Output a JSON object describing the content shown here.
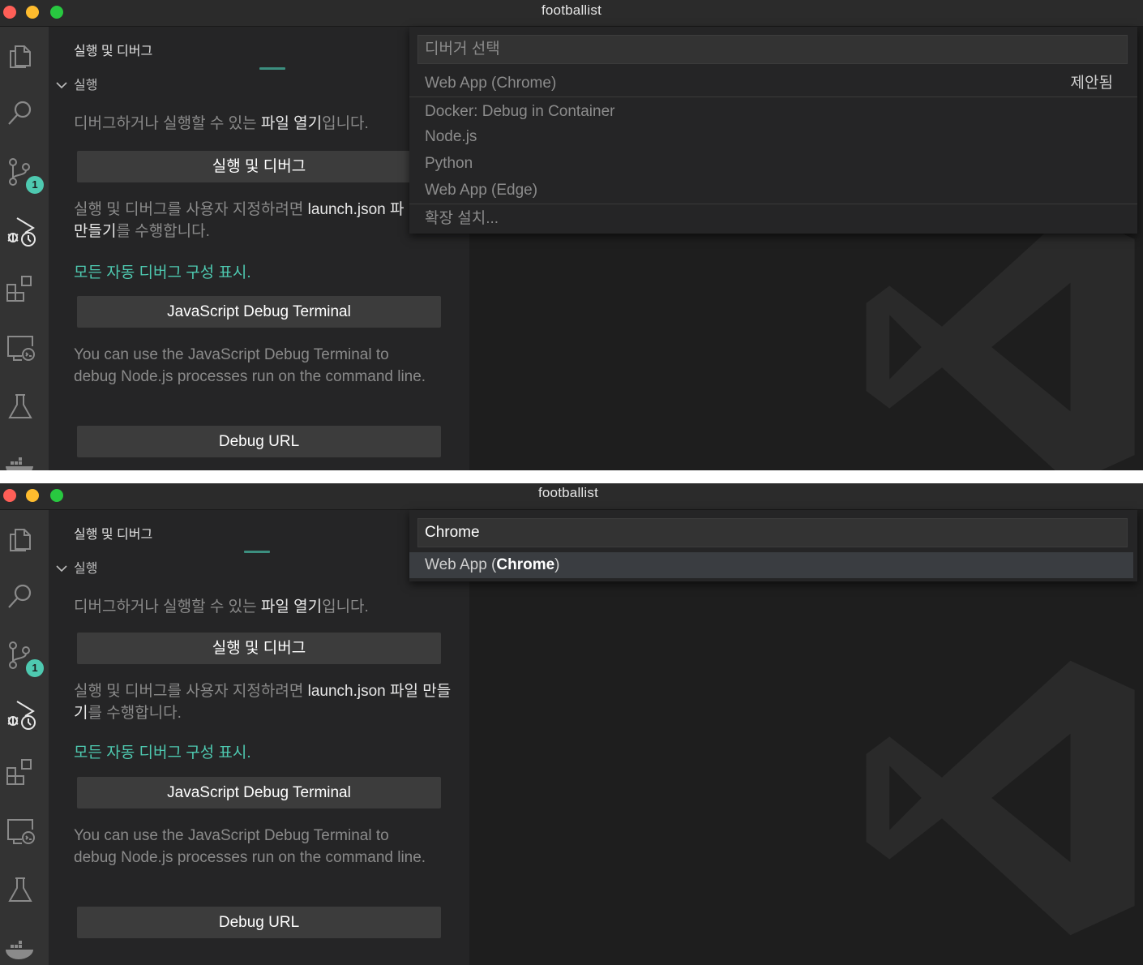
{
  "window": {
    "title": "footballist"
  },
  "activity": {
    "icons": [
      "explorer-icon",
      "search-icon",
      "source-control-icon",
      "run-debug-icon",
      "extensions-icon",
      "remote-explorer-icon",
      "testing-icon",
      "docker-icon"
    ],
    "source_control_badge": "1"
  },
  "sidebar": {
    "title": "실행 및 디버그",
    "section": "실행",
    "open_file_pre": "디버그하거나 실행할 수 있는 ",
    "open_file_link": "파일 열기",
    "open_file_post": "입니다.",
    "run_debug_button": "실행 및 디버그",
    "customize_pre": "실행 및 디버그를 사용자 지정하려면 ",
    "customize_link": "launch.json 파일 만들기",
    "customize_link_cut": "launch.json 파",
    "customize_link_line2": "만들기",
    "customize_post": "를 수행합니다.",
    "show_all": "모든 자동 디버그 구성 표시.",
    "js_terminal_button": "JavaScript Debug Terminal",
    "js_terminal_desc": "You can use the JavaScript Debug Terminal to debug Node.js processes run on the command line.",
    "debug_url_button": "Debug URL"
  },
  "palette1": {
    "placeholder": "디버거 선택",
    "items": [
      {
        "label": "Web App (Chrome)",
        "tag": "제안됨"
      },
      {
        "label": "Docker: Debug in Container"
      },
      {
        "label": "Node.js"
      },
      {
        "label": "Python"
      },
      {
        "label": "Web App (Edge)"
      },
      {
        "label": "확장 설치..."
      }
    ]
  },
  "palette2": {
    "value": "Chrome",
    "result_pre": "Web App (",
    "result_match": "Chrome",
    "result_post": ")"
  }
}
